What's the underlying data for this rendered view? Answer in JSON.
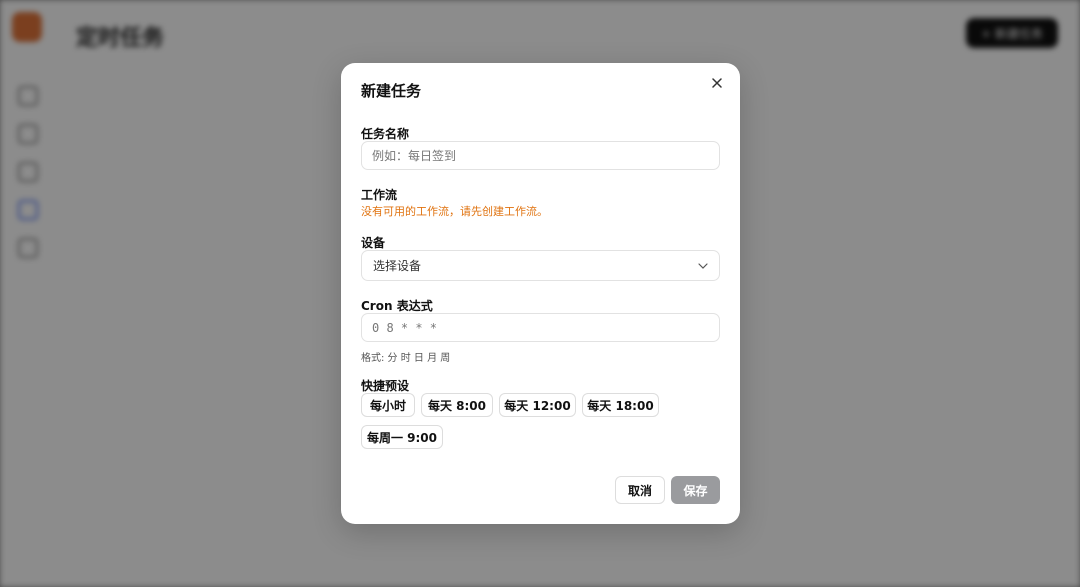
{
  "modal": {
    "title": "新建任务",
    "task_name": {
      "label": "任务名称",
      "placeholder": "例如：每日签到",
      "value": ""
    },
    "workflow": {
      "label": "工作流",
      "warning": "没有可用的工作流，请先创建工作流。"
    },
    "device": {
      "label": "设备",
      "placeholder": "选择设备"
    },
    "cron": {
      "label": "Cron 表达式",
      "placeholder": "0 8 * * *",
      "value": "",
      "hint": "格式: 分 时 日 月 周"
    },
    "presets": {
      "label": "快捷预设",
      "items": [
        "每小时",
        "每天 8:00",
        "每天 12:00",
        "每天 18:00",
        "每周一 9:00"
      ]
    },
    "cancel_label": "取消",
    "save_label": "保存"
  },
  "colors": {
    "warning": "#e07310",
    "save_disabled": "#9a9b9e",
    "overlay": "rgba(0,0,0,0.45)"
  }
}
